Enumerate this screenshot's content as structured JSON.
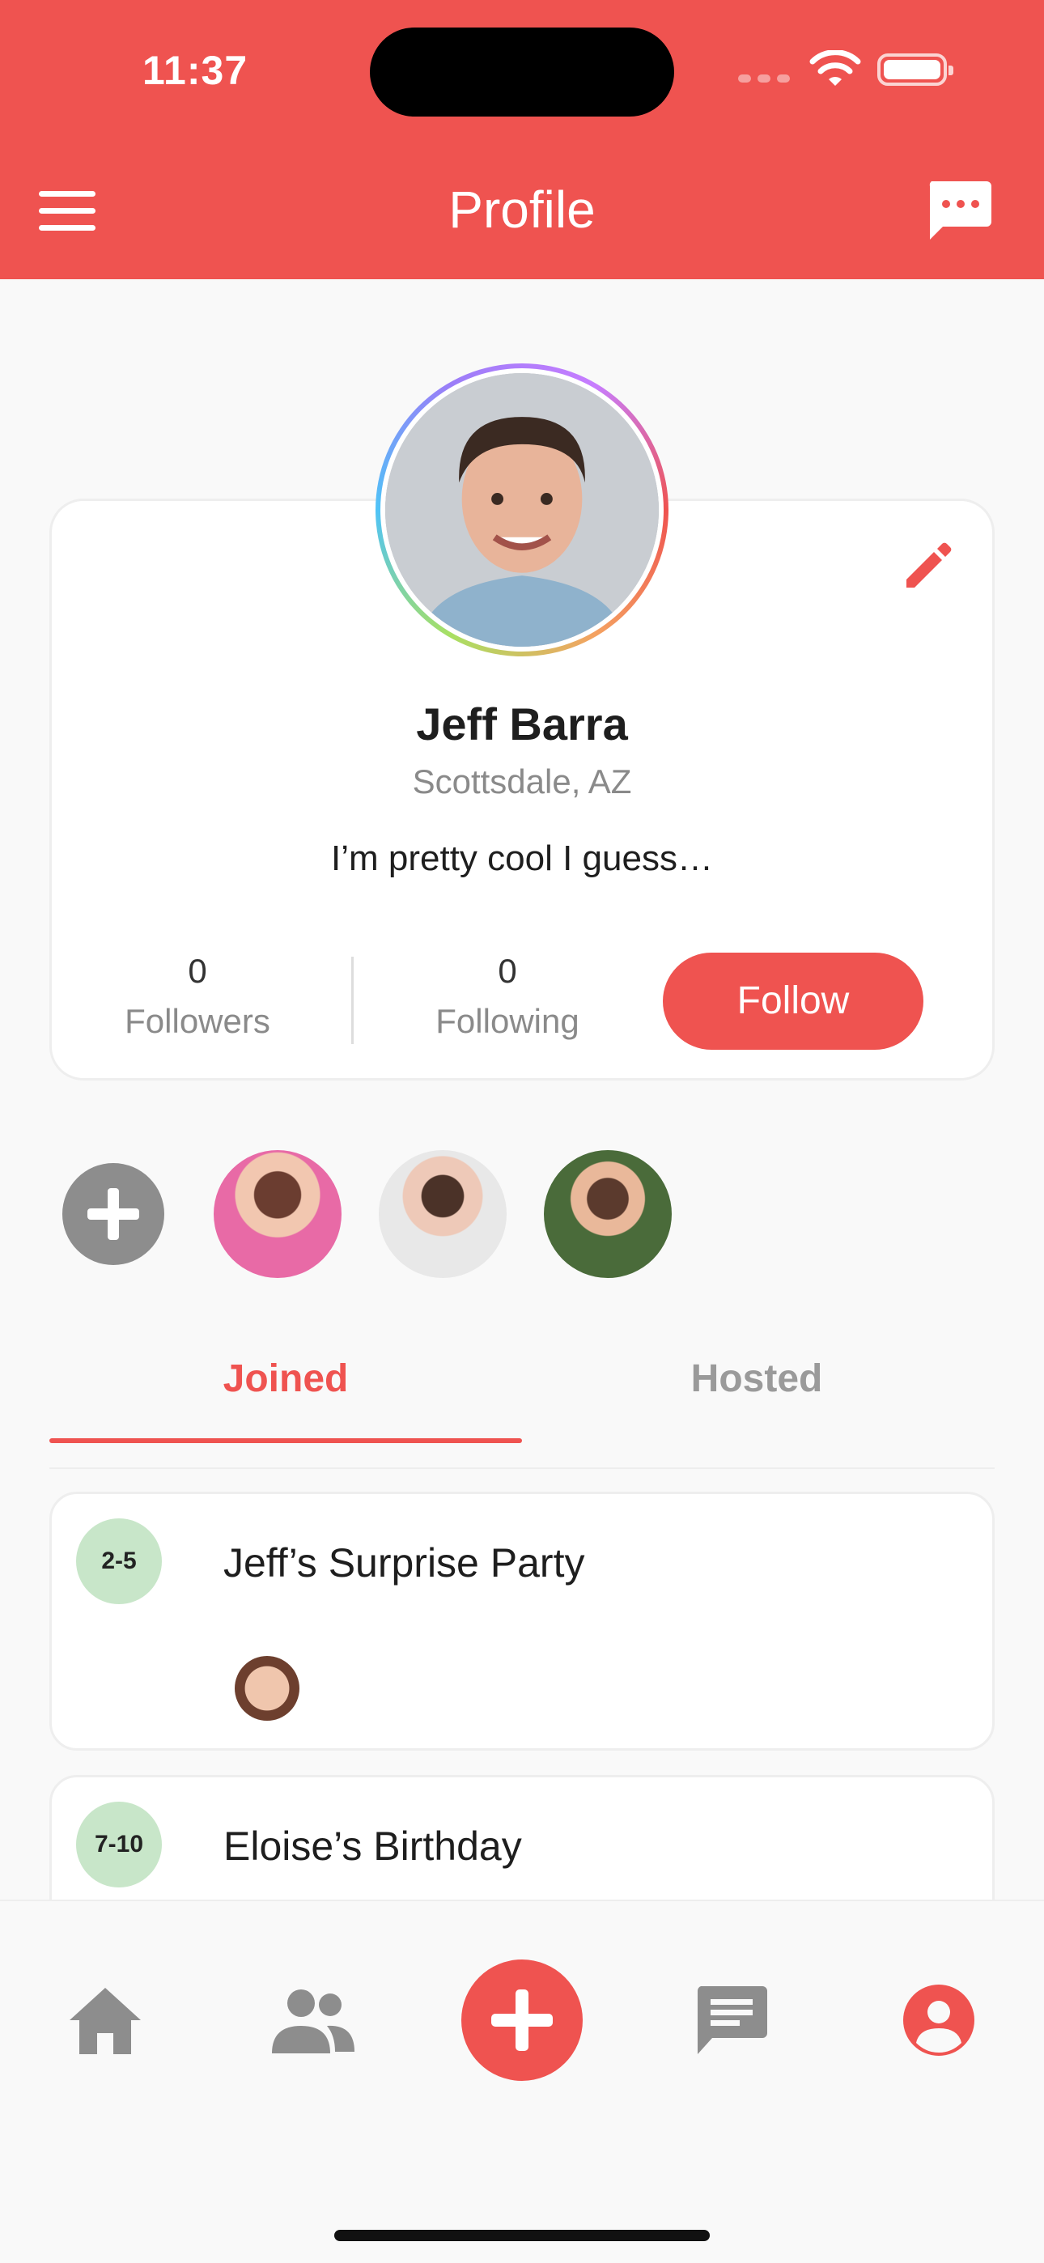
{
  "status_bar": {
    "time": "11:37"
  },
  "header": {
    "title": "Profile"
  },
  "profile": {
    "name": "Jeff Barra",
    "location": "Scottsdale, AZ",
    "bio": "I’m pretty cool I guess…",
    "followers_count": "0",
    "followers_label": "Followers",
    "following_count": "0",
    "following_label": "Following",
    "follow_label": "Follow"
  },
  "tabs": [
    {
      "label": "Joined",
      "active": true
    },
    {
      "label": "Hosted",
      "active": false
    }
  ],
  "events": [
    {
      "date": "2-5",
      "title": "Jeff’s Surprise Party"
    },
    {
      "date": "7-10",
      "title": "Eloise’s Birthday"
    }
  ],
  "colors": {
    "accent": "#ef5350",
    "date_badge": "#c8e6c9",
    "icon_gray": "#8d8d8d"
  },
  "icons": {
    "header": [
      "menu-icon",
      "chat-bubble-icon"
    ],
    "profile": [
      "edit-pencil-icon"
    ],
    "nav": [
      "home-icon",
      "people-icon",
      "add-icon",
      "messages-icon",
      "account-icon"
    ]
  }
}
